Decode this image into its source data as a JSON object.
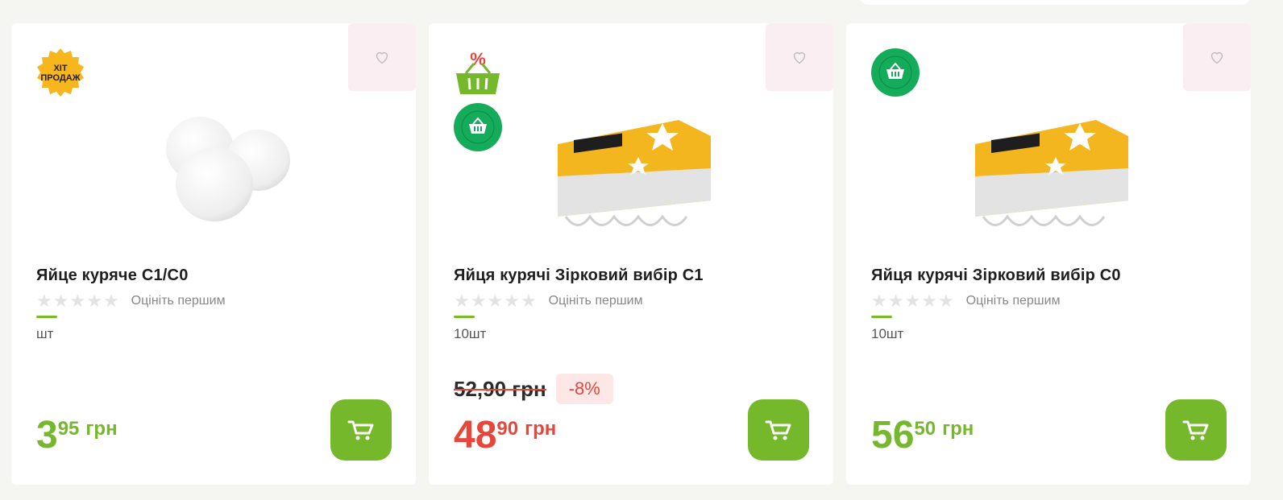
{
  "colors": {
    "accent": "#75b82b",
    "sale": "#e8463b",
    "fav_bg": "#fbeef2"
  },
  "products": [
    {
      "title": "Яйце куряче С1/С0",
      "rating_text": "Оцініть першим",
      "unit": "шт",
      "price_int": "3",
      "price_frac": "95",
      "currency": "грн",
      "badges": [
        "hit-sale-badge-icon"
      ],
      "hit_badge_line1": "ХІТ",
      "hit_badge_line2": "ПРОДАЖ"
    },
    {
      "title": "Яйця курячі Зірковий вибір С1",
      "rating_text": "Оцініть першим",
      "unit": "10шт",
      "old_price": "52,90 грн",
      "discount": "-8%",
      "price_int": "48",
      "price_frac": "90",
      "currency": "грн",
      "badges": [
        "promo-basket-icon",
        "own-brand-badge-icon"
      ]
    },
    {
      "title": "Яйця курячі Зірковий вибір С0",
      "rating_text": "Оцініть першим",
      "unit": "10шт",
      "price_int": "56",
      "price_frac": "50",
      "currency": "грн",
      "badges": [
        "own-brand-badge-icon"
      ]
    }
  ]
}
